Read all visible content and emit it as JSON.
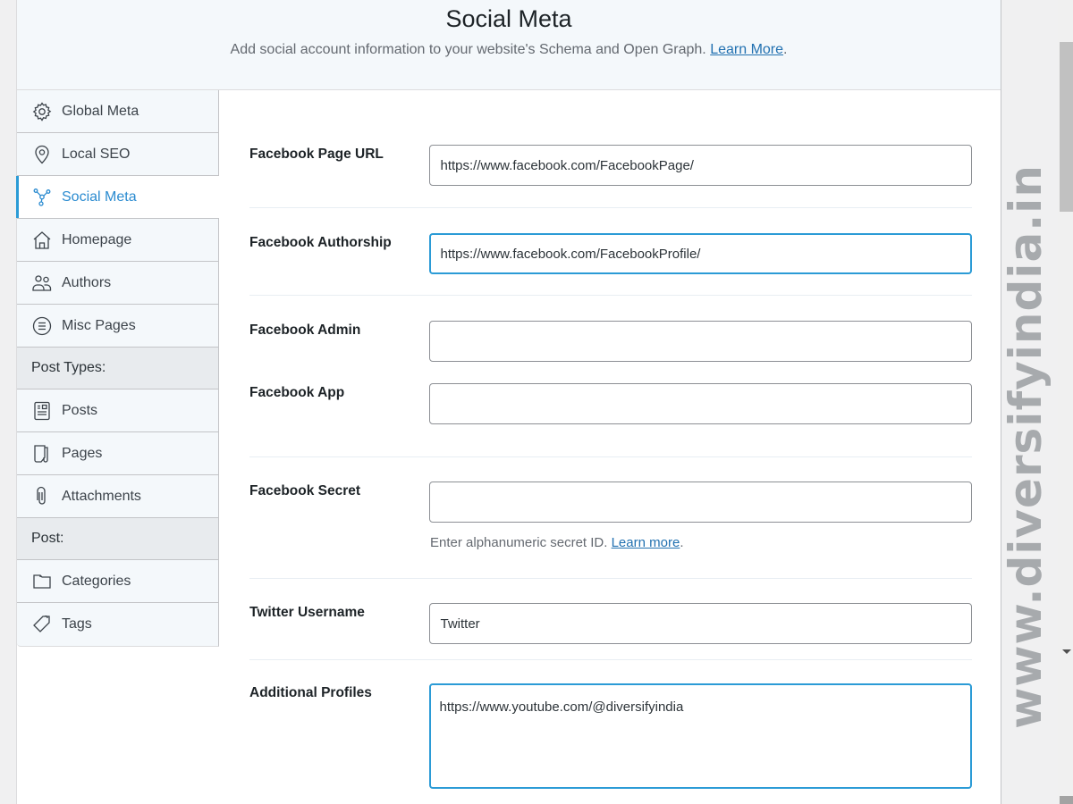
{
  "header": {
    "title": "Social Meta",
    "description": "Add social account information to your website's Schema and Open Graph.",
    "learn_more": "Learn More"
  },
  "sidebar": {
    "items": [
      {
        "label": "Global Meta",
        "icon": "gear-icon"
      },
      {
        "label": "Local SEO",
        "icon": "location-pin-icon"
      },
      {
        "label": "Social Meta",
        "icon": "share-nodes-icon",
        "active": true
      },
      {
        "label": "Homepage",
        "icon": "home-icon"
      },
      {
        "label": "Authors",
        "icon": "users-icon"
      },
      {
        "label": "Misc Pages",
        "icon": "list-circle-icon"
      }
    ],
    "post_types_heading": "Post Types:",
    "post_types": [
      {
        "label": "Posts",
        "icon": "post-icon"
      },
      {
        "label": "Pages",
        "icon": "page-icon"
      },
      {
        "label": "Attachments",
        "icon": "paperclip-icon"
      }
    ],
    "post_heading": "Post:",
    "post": [
      {
        "label": "Categories",
        "icon": "folder-icon"
      },
      {
        "label": "Tags",
        "icon": "tag-icon"
      }
    ]
  },
  "form": {
    "facebook_page_url": {
      "label": "Facebook Page URL",
      "value": "https://www.facebook.com/FacebookPage/"
    },
    "facebook_authorship": {
      "label": "Facebook Authorship",
      "value": "https://www.facebook.com/FacebookProfile/"
    },
    "facebook_admin": {
      "label": "Facebook Admin",
      "value": ""
    },
    "facebook_app": {
      "label": "Facebook App",
      "value": ""
    },
    "facebook_secret": {
      "label": "Facebook Secret",
      "value": "",
      "help": "Enter alphanumeric secret ID.",
      "help_link": "Learn more"
    },
    "twitter_username": {
      "label": "Twitter Username",
      "value": "Twitter"
    },
    "additional_profiles": {
      "label": "Additional Profiles",
      "value": "https://www.youtube.com/@diversifyindia"
    }
  },
  "watermark": "www.diversifyindia.in",
  "colors": {
    "accent": "#2b9bd6",
    "link": "#2271b1"
  }
}
